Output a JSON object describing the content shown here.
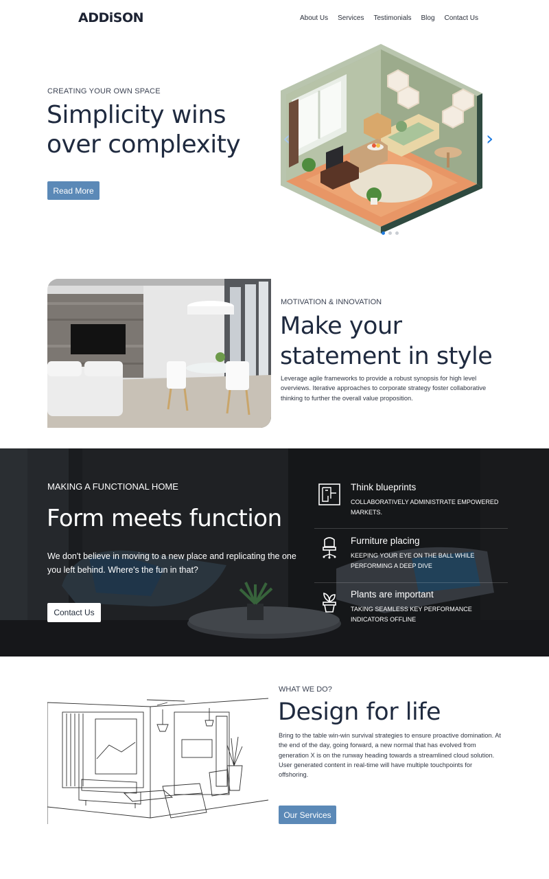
{
  "nav": {
    "logo": "ADDiSON",
    "items": [
      "About Us",
      "Services",
      "Testimonials",
      "Blog",
      "Contact Us"
    ]
  },
  "hero": {
    "kicker": "CREATING YOUR OWN SPACE",
    "title": "Simplicity wins over complexity",
    "button": "Read More",
    "arrow_prev": "‹",
    "arrow_next": "›",
    "slides_total": 3,
    "active_slide": 1
  },
  "motivation": {
    "kicker": "MOTIVATION & INNOVATION",
    "title": "Make your statement in style",
    "body": "Leverage agile frameworks to provide a robust synopsis for high level overviews. Iterative approaches to corporate strategy foster collaborative thinking to further the overall value proposition."
  },
  "functional": {
    "kicker": "MAKING A FUNCTIONAL HOME",
    "title": "Form meets function",
    "body": "We don't believe in moving to a new place and replicating the one you left behind. Where's the fun in that?",
    "button": "Contact Us",
    "features": [
      {
        "icon": "blueprint-icon",
        "title": "Think blueprints",
        "desc": "COLLABORATIVELY ADMINISTRATE EMPOWERED MARKETS."
      },
      {
        "icon": "office-chair-icon",
        "title": "Furniture placing",
        "desc": "KEEPING YOUR EYE ON THE BALL WHILE PERFORMING A DEEP DIVE"
      },
      {
        "icon": "potted-plant-icon",
        "title": "Plants are important",
        "desc": "TAKING SEAMLESS KEY PERFORMANCE INDICATORS OFFLINE"
      }
    ]
  },
  "services": {
    "kicker": "WHAT WE DO?",
    "title": "Design for life",
    "body": "Bring to the table win-win survival strategies to ensure proactive domination. At the end of the day, going forward, a new normal that has evolved from generation X is on the runway heading towards a streamlined cloud solution. User generated content in real-time will have multiple touchpoints for offshoring.",
    "button": "Our Services"
  }
}
